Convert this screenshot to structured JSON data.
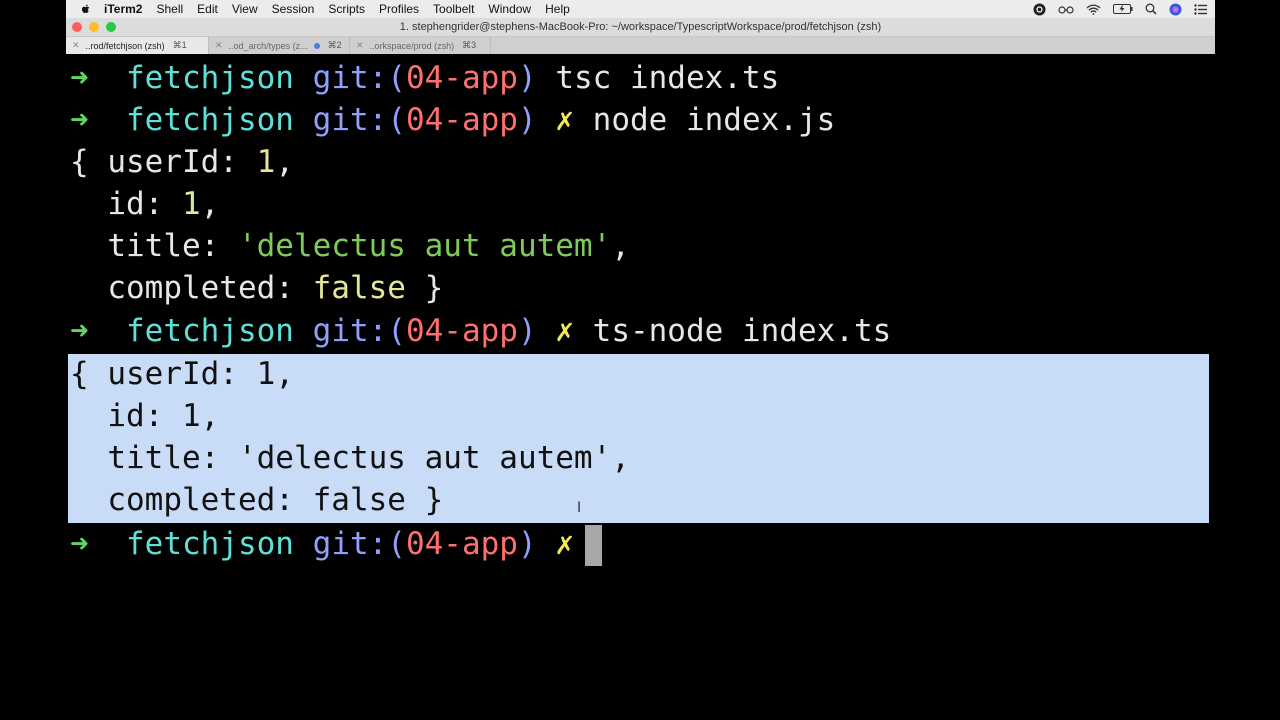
{
  "menubar": {
    "app_name": "iTerm2",
    "items": [
      "Shell",
      "Edit",
      "View",
      "Session",
      "Scripts",
      "Profiles",
      "Toolbelt",
      "Window",
      "Help"
    ]
  },
  "window": {
    "title": "1. stephengrider@stephens-MacBook-Pro: ~/workspace/TypescriptWorkspace/prod/fetchjson (zsh)"
  },
  "tabs": [
    {
      "label": "..rod/fetchjson (zsh)",
      "shortcut": "⌘1",
      "active": true
    },
    {
      "label": "..od_arch/types (z...",
      "shortcut": "⌘2",
      "active": false,
      "has_dot": true
    },
    {
      "label": "..orkspace/prod (zsh)",
      "shortcut": "⌘3",
      "active": false
    }
  ],
  "prompt": {
    "arrow": "➜",
    "dir": "fetchjson",
    "git_prefix": "git:(",
    "branch": "04-app",
    "git_suffix": ")",
    "dirty_mark": "✗"
  },
  "commands": {
    "cmd1": "tsc index.ts",
    "cmd2": "node index.js",
    "cmd3": "ts-node index.ts"
  },
  "output": {
    "open_brace": "{ ",
    "userId_key": "userId: ",
    "userId_val": "1",
    "comma": ",",
    "id_key": "  id: ",
    "id_val": "1",
    "title_key": "  title: ",
    "title_val": "'delectus aut autem'",
    "completed_key": "  completed: ",
    "completed_val": "false",
    "close_brace": " }"
  },
  "colors": {
    "arrow": "#5fd45f",
    "dir": "#5ee0d8",
    "git": "#8fa0ff",
    "branch": "#ff6f6f",
    "dirty": "#f4e75a",
    "string": "#7ecb5b",
    "number": "#e5e59a",
    "selection": "#c9dcf7"
  }
}
